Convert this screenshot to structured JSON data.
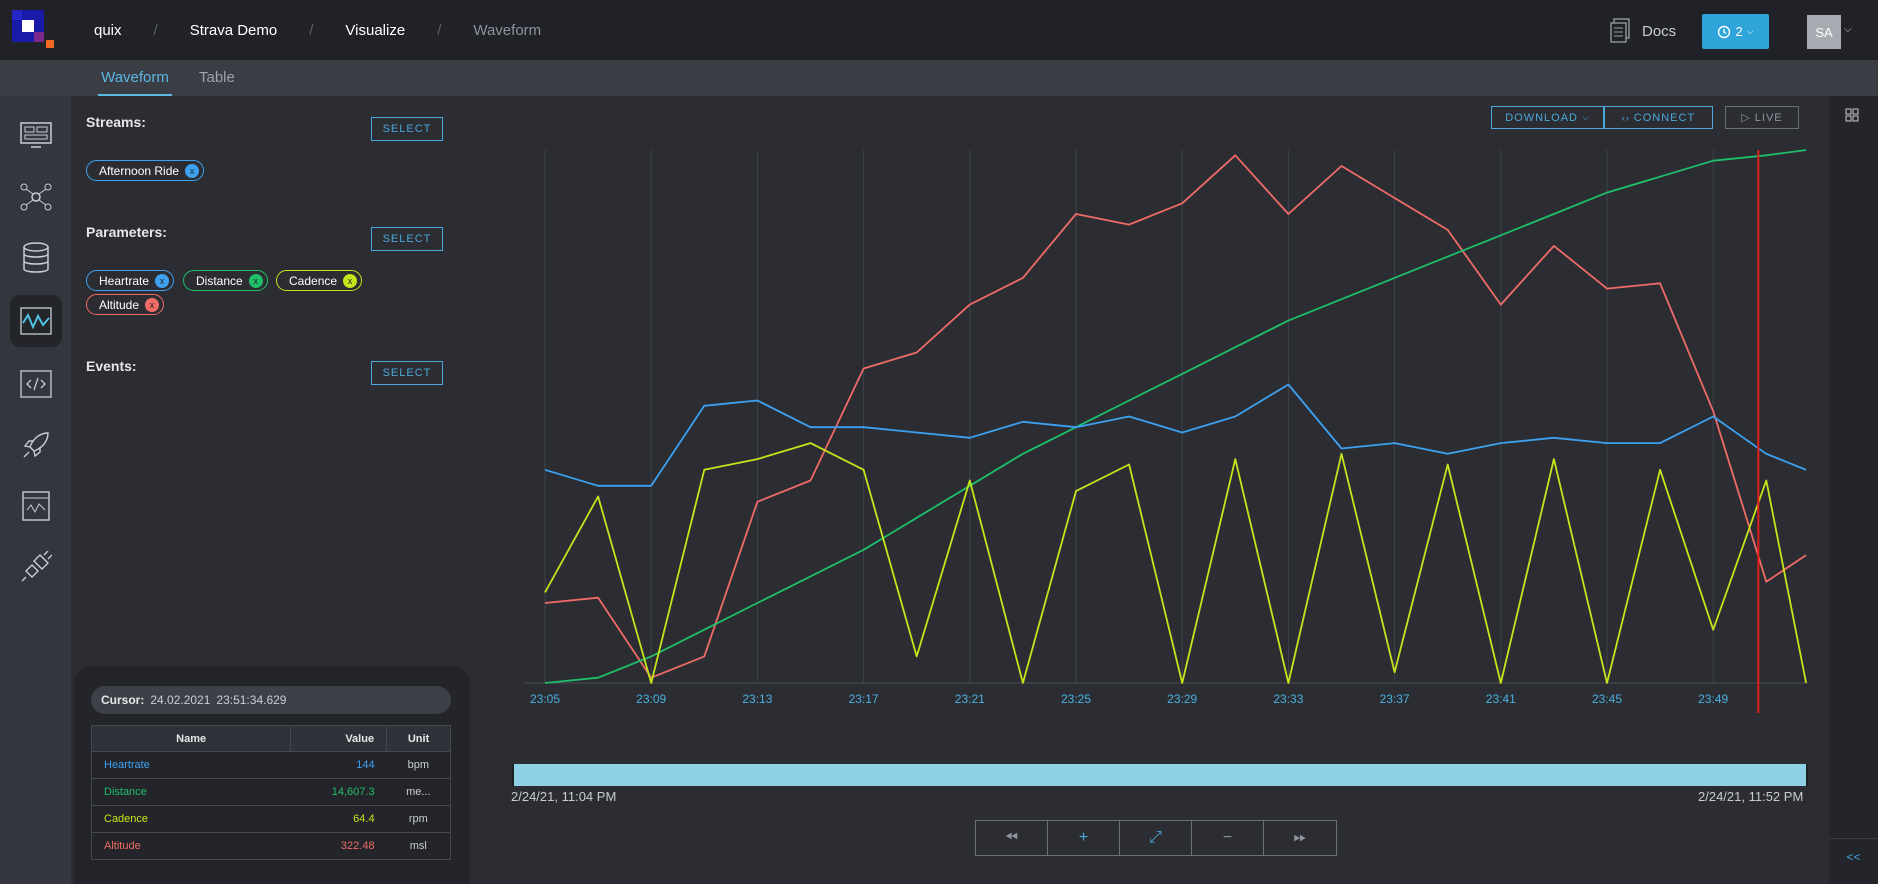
{
  "header": {
    "breadcrumbs": [
      "quix",
      "Strava Demo",
      "Visualize",
      "Waveform"
    ],
    "docs_label": "Docs",
    "history_count": "2",
    "avatar_initials": "SA"
  },
  "tabs": [
    {
      "label": "Waveform",
      "active": true
    },
    {
      "label": "Table",
      "active": false
    }
  ],
  "rail": {
    "items": [
      "monitor-icon",
      "pipeline-icon",
      "database-icon",
      "waveform-icon",
      "code-icon",
      "rocket-icon",
      "report-icon",
      "plug-icon"
    ],
    "active": "waveform-icon"
  },
  "panel": {
    "streams_title": "Streams:",
    "parameters_title": "Parameters:",
    "events_title": "Events:",
    "select_label": "SELECT",
    "streams": [
      {
        "label": "Afternoon Ride",
        "color": "#3da1f0"
      }
    ],
    "parameters": [
      {
        "label": "Heartrate",
        "color": "#3da1f0"
      },
      {
        "label": "Distance",
        "color": "#1fbf6a"
      },
      {
        "label": "Cadence",
        "color": "#c5e51b"
      },
      {
        "label": "Altitude",
        "color": "#f06b66"
      }
    ]
  },
  "cursor": {
    "label": "Cursor:",
    "date": "24.02.2021",
    "time": "23:51:34.629",
    "columns": [
      "Name",
      "Value",
      "Unit"
    ],
    "rows": [
      {
        "name": "Heartrate",
        "value": "144",
        "unit": "bpm",
        "color": "#3da1f0"
      },
      {
        "name": "Distance",
        "value": "14,607.3",
        "unit": "me...",
        "color": "#1fbf6a"
      },
      {
        "name": "Cadence",
        "value": "64.4",
        "unit": "rpm",
        "color": "#c5e51b"
      },
      {
        "name": "Altitude",
        "value": "322.48",
        "unit": "msl",
        "color": "#f06b66"
      }
    ]
  },
  "toolbar": {
    "download_label": "DOWNLOAD",
    "connect_label": "CONNECT",
    "live_label": "LIVE"
  },
  "range": {
    "start": "2/24/21, 11:04 PM",
    "end": "2/24/21, 11:52 PM"
  },
  "chart_data": {
    "type": "line",
    "x_ticks": [
      "23:05",
      "23:09",
      "23:13",
      "23:17",
      "23:21",
      "23:25",
      "23:29",
      "23:33",
      "23:37",
      "23:41",
      "23:45",
      "23:49"
    ],
    "x_minutes": [
      0,
      2,
      4,
      6,
      8,
      10,
      12,
      14,
      16,
      18,
      20,
      22,
      24,
      26,
      28,
      30,
      32,
      34,
      36,
      38,
      40,
      42,
      44,
      46,
      47.5
    ],
    "cursor_minute": 45.7,
    "series": [
      {
        "name": "Altitude",
        "color": "#f06b66",
        "values": [
          0.15,
          0.16,
          0.01,
          0.05,
          0.34,
          0.38,
          0.59,
          0.62,
          0.71,
          0.76,
          0.88,
          0.86,
          0.9,
          0.99,
          0.88,
          0.97,
          0.91,
          0.85,
          0.71,
          0.82,
          0.74,
          0.75,
          0.51,
          0.19,
          0.24
        ]
      },
      {
        "name": "Heartrate",
        "color": "#3da1f0",
        "values": [
          0.4,
          0.37,
          0.37,
          0.52,
          0.53,
          0.48,
          0.48,
          0.47,
          0.46,
          0.49,
          0.48,
          0.5,
          0.47,
          0.5,
          0.56,
          0.44,
          0.45,
          0.43,
          0.45,
          0.46,
          0.45,
          0.45,
          0.5,
          0.43,
          0.4
        ]
      },
      {
        "name": "Distance",
        "color": "#1fbf6a",
        "values": [
          0.0,
          0.01,
          0.05,
          0.1,
          0.15,
          0.2,
          0.25,
          0.31,
          0.37,
          0.43,
          0.48,
          0.53,
          0.58,
          0.63,
          0.68,
          0.72,
          0.76,
          0.8,
          0.84,
          0.88,
          0.92,
          0.95,
          0.98,
          0.99,
          1.0
        ]
      },
      {
        "name": "Cadence",
        "color": "#c5e51b",
        "values": [
          0.17,
          0.35,
          0.0,
          0.4,
          0.42,
          0.45,
          0.4,
          0.05,
          0.38,
          0.0,
          0.36,
          0.41,
          0.0,
          0.42,
          0.0,
          0.43,
          0.02,
          0.41,
          0.0,
          0.42,
          0.0,
          0.4,
          0.1,
          0.38,
          0.0
        ]
      }
    ]
  }
}
